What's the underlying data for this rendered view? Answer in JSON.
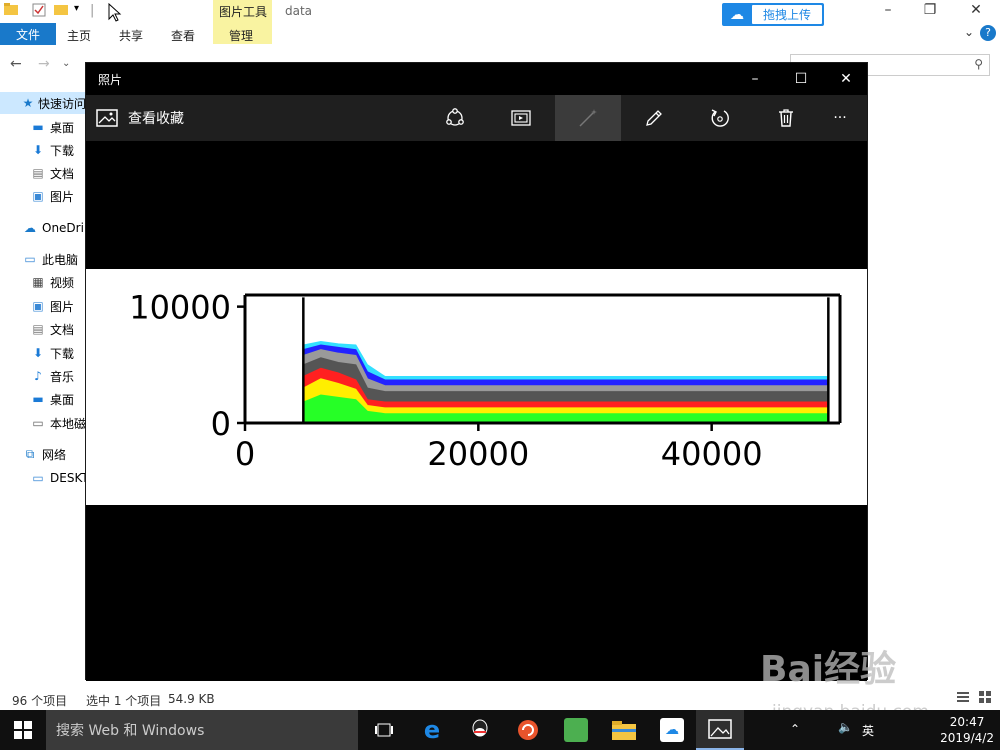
{
  "explorer": {
    "title": "data",
    "contextual_tab_group": "图片工具",
    "tabs": [
      "文件",
      "主页",
      "共享",
      "查看",
      "管理"
    ],
    "baidu_button": "拖拽上传",
    "help": "?",
    "sidebar": {
      "items": [
        {
          "label": "快速访问",
          "icon": "star-icon"
        },
        {
          "label": "桌面",
          "icon": "desktop-icon"
        },
        {
          "label": "下载",
          "icon": "download-icon"
        },
        {
          "label": "文档",
          "icon": "document-icon"
        },
        {
          "label": "图片",
          "icon": "picture-icon"
        },
        {
          "label": "OneDri",
          "icon": "cloud-icon"
        },
        {
          "label": "此电脑",
          "icon": "computer-icon"
        },
        {
          "label": "视频",
          "icon": "video-icon"
        },
        {
          "label": "图片",
          "icon": "picture-icon"
        },
        {
          "label": "文档",
          "icon": "document-icon"
        },
        {
          "label": "下载",
          "icon": "download-icon"
        },
        {
          "label": "音乐",
          "icon": "music-icon"
        },
        {
          "label": "桌面",
          "icon": "desktop-icon"
        },
        {
          "label": "本地磁",
          "icon": "drive-icon"
        },
        {
          "label": "网络",
          "icon": "network-icon"
        },
        {
          "label": "DESKT",
          "icon": "monitor-icon"
        }
      ]
    },
    "status": {
      "count": "96 个项目",
      "selected": "选中 1 个项目",
      "size": "54.9 KB"
    }
  },
  "photos": {
    "title": "照片",
    "collection_label": "查看收藏",
    "toolbar_icons": [
      "share-icon",
      "slideshow-icon",
      "enhance-icon",
      "edit-icon",
      "rotate-icon",
      "delete-icon",
      "more-icon"
    ],
    "more_label": "···"
  },
  "chart_data": {
    "type": "area",
    "title": "",
    "xlabel": "",
    "ylabel": "",
    "xlim": [
      0,
      51000
    ],
    "ylim": [
      0,
      11000
    ],
    "x_ticks": [
      "0",
      "20000",
      "40000"
    ],
    "y_ticks": [
      "0",
      "10000"
    ],
    "vlines": [
      5000,
      50000
    ],
    "series": [
      {
        "color": "#26ff26",
        "x": [
          5000,
          6500,
          8000,
          9500,
          10500,
          12000,
          14000,
          50000
        ],
        "values": [
          1800,
          2400,
          2200,
          2000,
          1000,
          800,
          800,
          800
        ]
      },
      {
        "color": "#ffee00",
        "x": [
          5000,
          6500,
          8000,
          9500,
          10500,
          12000,
          14000,
          50000
        ],
        "values": [
          3000,
          3800,
          3400,
          2900,
          1500,
          1300,
          1300,
          1300
        ]
      },
      {
        "color": "#ff2020",
        "x": [
          5000,
          6500,
          8000,
          9500,
          10500,
          12000,
          14000,
          50000
        ],
        "values": [
          4000,
          4700,
          4300,
          3700,
          2000,
          1800,
          1800,
          1800
        ]
      },
      {
        "color": "#555555",
        "x": [
          5000,
          6500,
          8000,
          9500,
          10500,
          12000,
          14000,
          50000
        ],
        "values": [
          5000,
          5600,
          5200,
          5000,
          3000,
          2700,
          2700,
          2700
        ]
      },
      {
        "color": "#9a9a9a",
        "x": [
          5000,
          6500,
          8000,
          9500,
          10500,
          12000,
          14000,
          50000
        ],
        "values": [
          5800,
          6300,
          6000,
          5800,
          3800,
          3200,
          3200,
          3200
        ]
      },
      {
        "color": "#2222ff",
        "x": [
          5000,
          6500,
          8000,
          9500,
          10500,
          12000,
          14000,
          50000
        ],
        "values": [
          6300,
          6700,
          6500,
          6300,
          4400,
          3700,
          3700,
          3700
        ]
      },
      {
        "color": "#33e0ff",
        "x": [
          5000,
          6500,
          8000,
          9500,
          10500,
          12000,
          14000,
          50000
        ],
        "values": [
          6700,
          7000,
          6800,
          6700,
          5000,
          4000,
          4000,
          4000
        ]
      }
    ]
  },
  "taskbar": {
    "search_placeholder": "搜索 Web 和 Windows",
    "ime": "英",
    "time": "20:47",
    "date": "2019/4/2"
  },
  "watermark": {
    "brand": "Bai经验",
    "url": "jingyan.baidu.com"
  }
}
